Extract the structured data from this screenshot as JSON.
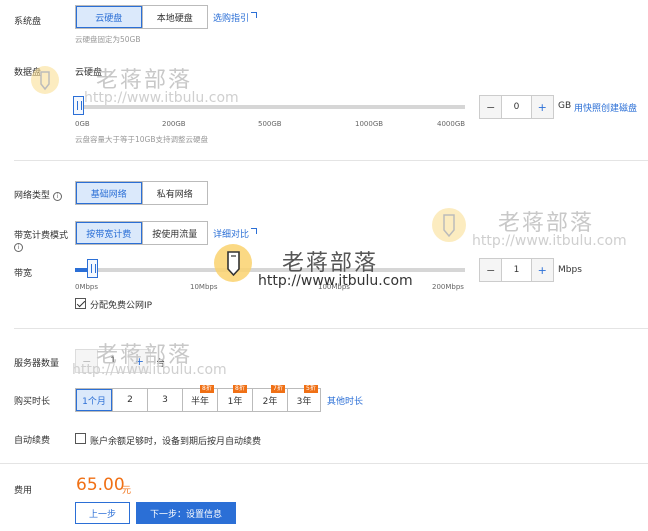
{
  "system_disk": {
    "label": "系统盘",
    "options": [
      "云硬盘",
      "本地硬盘"
    ],
    "selected": "云硬盘",
    "guide_link": "选购指引",
    "hint": "云硬盘固定为50GB"
  },
  "data_disk": {
    "label": "数据盘",
    "type": "云硬盘",
    "ticks": [
      "0GB",
      "200GB",
      "500GB",
      "1000GB",
      "4000GB"
    ],
    "value": "0",
    "unit": "GB",
    "snapshot_link": "用快照创建磁盘",
    "hint": "云盘容量大于等于10GB支持调整云硬盘"
  },
  "network_type": {
    "label": "网络类型",
    "info_glyph": "i",
    "options": [
      "基础网络",
      "私有网络"
    ],
    "selected": "基础网络"
  },
  "billing_mode": {
    "label": "带宽计费模式",
    "info_glyph": "i",
    "options": [
      "按带宽计费",
      "按使用流量"
    ],
    "selected": "按带宽计费",
    "compare_link": "详细对比"
  },
  "bandwidth": {
    "label": "带宽",
    "ticks": [
      "0Mbps",
      "10Mbps",
      "100Mbps",
      "200Mbps"
    ],
    "value": "1",
    "unit": "Mbps",
    "public_ip_label": "分配免费公网IP",
    "public_ip_checked": true
  },
  "server_count": {
    "label": "服务器数量",
    "value": "1",
    "unit": "台"
  },
  "duration": {
    "label": "购买时长",
    "options": [
      "1个月",
      "2",
      "3",
      "半年",
      "1年",
      "2年",
      "3年"
    ],
    "selected": "1个月",
    "badges": [
      "8折",
      "8折",
      "7折",
      "5折"
    ],
    "other_link": "其他时长"
  },
  "auto_renew": {
    "label": "自动续费",
    "text": "账户余额足够时，设备到期后按月自动续费",
    "checked": false
  },
  "fee": {
    "label": "费用",
    "amount": "65.00",
    "currency": "元"
  },
  "buttons": {
    "prev": "上一步",
    "next": "下一步：设置信息"
  },
  "watermark": {
    "text": "老蒋部落",
    "url": "http://www.itbulu.com"
  },
  "colors": {
    "accent": "#2b6fd6",
    "price": "#f07015",
    "badge": "#f07015"
  }
}
